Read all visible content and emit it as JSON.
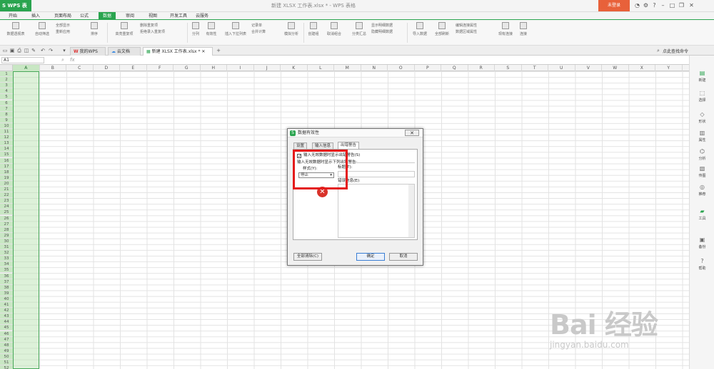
{
  "titlebar": {
    "app_label": "S WPS 表格",
    "doc_title": "新建 XLSX 工作表.xlsx * - WPS 表格",
    "login": "未登录"
  },
  "menu": [
    "开始",
    "插入",
    "页面布局",
    "公式",
    "数据",
    "审阅",
    "视图",
    "开发工具",
    "云服务"
  ],
  "active_menu": "数据",
  "ribbon": {
    "pivot": "数据透视表",
    "autofilter": "自动筛选",
    "show_all": "全部显示",
    "reapply": "重新应用",
    "sort": "排序",
    "highlight_dup": "高亮重复项",
    "delete_dup": "删除重复项",
    "reject_dup": "拒绝录入重复项",
    "split": "分列",
    "validity": "有效性",
    "dropdown": "插入下拉列表",
    "record": "记录单",
    "consolidate": "合并计算",
    "simulate": "模拟分析",
    "group": "创建组",
    "ungroup": "取消组合",
    "subtotal": "分类汇总",
    "show_detail": "显示明细数据",
    "hide_detail": "隐藏明细数据",
    "import": "导入数据",
    "refresh_all": "全部刷新",
    "edit_conn": "编辑连接属性",
    "data_area": "数据区域属性",
    "existing_conn": "现有连接",
    "connect": "连接"
  },
  "tabbar": {
    "tabs": [
      {
        "label": "我的WPS"
      },
      {
        "label": "云文档"
      },
      {
        "label": "新建 XLSX 工作表.xlsx *"
      }
    ],
    "find_cmd": "点此查找命令"
  },
  "formula": {
    "namebox": "A1",
    "fx": "fx"
  },
  "columns": [
    "A",
    "B",
    "C",
    "D",
    "E",
    "F",
    "G",
    "H",
    "I",
    "J",
    "K",
    "L",
    "M",
    "N",
    "O",
    "P",
    "Q",
    "R",
    "S",
    "T",
    "U",
    "V",
    "W",
    "X",
    "Y"
  ],
  "rows": [
    "1",
    "2",
    "3",
    "4",
    "5",
    "6",
    "7",
    "8",
    "9",
    "10",
    "11",
    "12",
    "13",
    "14",
    "15",
    "16",
    "17",
    "18",
    "19",
    "20",
    "21",
    "22",
    "23",
    "24",
    "25",
    "26",
    "27",
    "28",
    "29",
    "30",
    "31",
    "32",
    "33",
    "34",
    "35",
    "36",
    "37",
    "38",
    "39",
    "40",
    "41",
    "42",
    "43",
    "44",
    "45",
    "46",
    "47",
    "48",
    "49",
    "50",
    "51",
    "52"
  ],
  "rpanel": [
    "新建",
    "选择",
    "形状",
    "属性",
    "分析",
    "传图",
    "推荐",
    "工具",
    "备份",
    "帮助"
  ],
  "dialog": {
    "title": "数据有效性",
    "close": "✕",
    "tabs": [
      "设置",
      "输入信息",
      "出错警告"
    ],
    "checkbox": "输入无效数据时显示出错警告(S)",
    "group_label": "输入无效数据时显示下列出错警告:",
    "style_label": "样式(Y):",
    "style_value": "停止",
    "title_label": "标题(T):",
    "msg_label": "错误信息(E):",
    "clear_all": "全部清除(C)",
    "ok": "确定",
    "cancel": "取消"
  },
  "watermark": {
    "text": "Bai 经验",
    "url": "jingyan.baidu.com"
  }
}
